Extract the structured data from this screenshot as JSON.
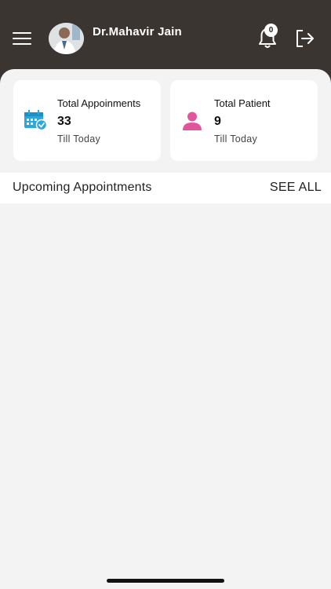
{
  "header": {
    "doctor_name": "Dr.Mahavir Jain",
    "notification_count": "0",
    "background": "#3b3531"
  },
  "stats": [
    {
      "title": "Total Appoinments",
      "count": "33",
      "subtitle": "Till Today",
      "icon": "calendar-check-icon",
      "icon_color": "#29a8e0"
    },
    {
      "title": "Total Patient",
      "count": "9",
      "subtitle": "Till Today",
      "icon": "person-icon",
      "icon_color": "#e3559a"
    }
  ],
  "section": {
    "title": "Upcoming Appointments",
    "see_all": "SEE ALL"
  }
}
